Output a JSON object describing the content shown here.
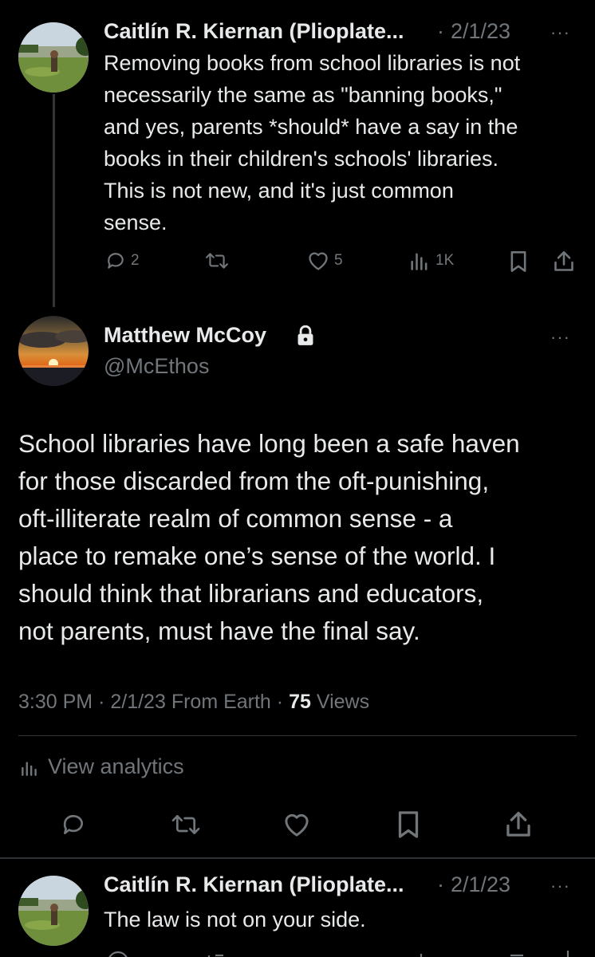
{
  "tweet1": {
    "author_name": "Caitlín R. Kiernan (Plioplate...",
    "separator": "·",
    "date": "2/1/23",
    "more": "···",
    "lines": [
      "Removing books from school libraries is not",
      "necessarily the same as \"banning books,\"",
      "and yes, parents *should* have a say in the",
      "books in their children's schools' libraries.",
      "This is not new, and it's just common",
      "sense."
    ],
    "reply_count": "2",
    "like_count": "5",
    "views_count": "1K"
  },
  "main_tweet": {
    "author_name": "Matthew McCoy",
    "handle": "@McEthos",
    "more": "···",
    "lines": [
      "School libraries have long been a safe haven",
      "for those discarded from the oft-punishing,",
      "oft-illiterate realm of common sense - a",
      "place to remake one’s sense of the world. I",
      "should think that librarians and educators,",
      "not parents, must have the final say."
    ],
    "time": "3:30 PM",
    "separator1": "·",
    "date": "2/1/23",
    "source": "From Earth",
    "separator2": "·",
    "views_count": "75",
    "views_label": "Views",
    "analytics_label": "View analytics"
  },
  "tweet3": {
    "author_name": "Caitlín R. Kiernan (Plioplate...",
    "separator": "·",
    "date": "2/1/23",
    "more": "···",
    "text": "The law is not on your side."
  },
  "colors": {
    "background": "#000000",
    "text": "#e7e9ea",
    "secondary": "#71767b",
    "divider": "#2f3336"
  },
  "icons": [
    "reply-icon",
    "retweet-icon",
    "like-icon",
    "views-icon",
    "bookmark-icon",
    "share-icon",
    "lock-icon",
    "analytics-icon",
    "more-icon"
  ]
}
